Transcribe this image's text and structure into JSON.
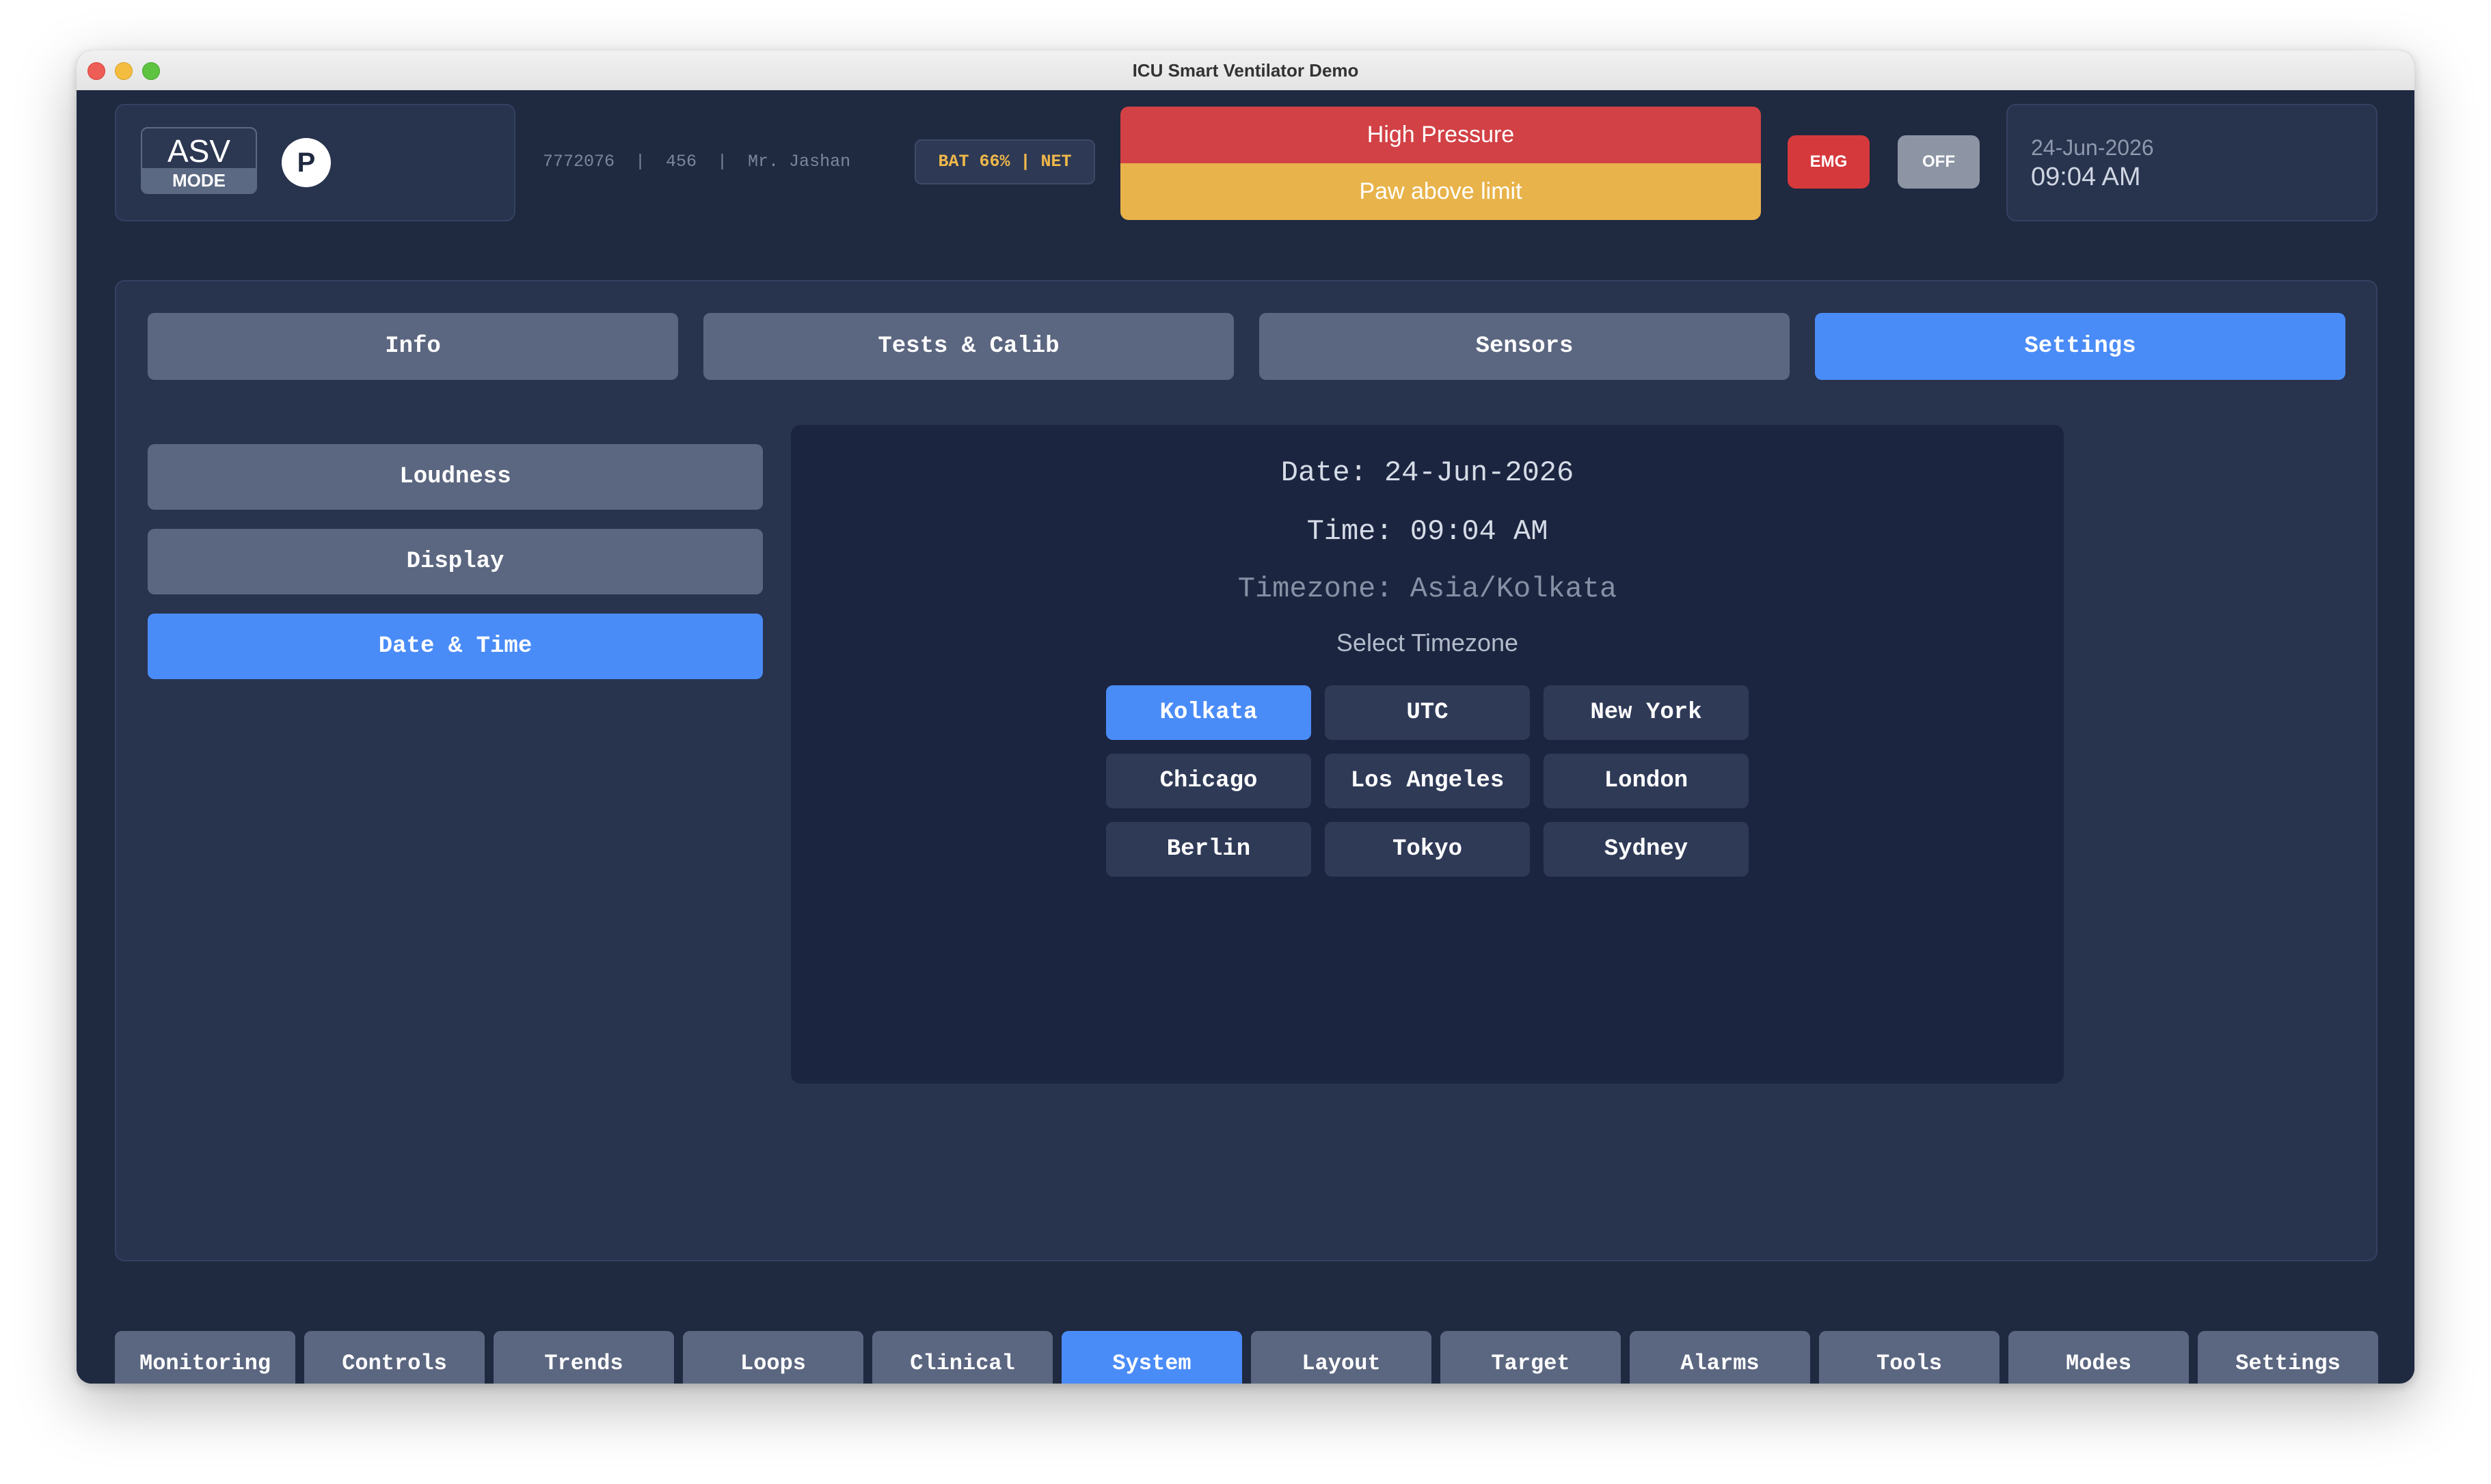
{
  "window": {
    "title": "ICU Smart Ventilator Demo"
  },
  "header": {
    "mode": {
      "name": "ASV",
      "label": "MODE"
    },
    "patient_badge": "P",
    "patient_info": "7772076  |  456  |  Mr. Jashan",
    "status_badge": "BAT 66% | NET",
    "alarms": {
      "primary": "High Pressure",
      "secondary": "Paw above limit"
    },
    "emergency_button": "EMG",
    "off_button": "OFF",
    "date": "24-Jun-2026",
    "time": "09:04 AM"
  },
  "tabs": [
    {
      "label": "Info",
      "active": false
    },
    {
      "label": "Tests & Calib",
      "active": false
    },
    {
      "label": "Sensors",
      "active": false
    },
    {
      "label": "Settings",
      "active": true
    }
  ],
  "sidebar": {
    "items": [
      {
        "label": "Loudness",
        "active": false
      },
      {
        "label": "Display",
        "active": false
      },
      {
        "label": "Date & Time",
        "active": true
      }
    ]
  },
  "datetime_panel": {
    "date_line": "Date: 24-Jun-2026",
    "time_line": "Time: 09:04 AM",
    "timezone_line": "Timezone: Asia/Kolkata",
    "select_label": "Select Timezone",
    "timezones": [
      {
        "label": "Kolkata",
        "active": true
      },
      {
        "label": "UTC",
        "active": false
      },
      {
        "label": "New York",
        "active": false
      },
      {
        "label": "Chicago",
        "active": false
      },
      {
        "label": "Los Angeles",
        "active": false
      },
      {
        "label": "London",
        "active": false
      },
      {
        "label": "Berlin",
        "active": false
      },
      {
        "label": "Tokyo",
        "active": false
      },
      {
        "label": "Sydney",
        "active": false
      }
    ]
  },
  "bottom_nav": [
    {
      "label": "Monitoring",
      "active": false
    },
    {
      "label": "Controls",
      "active": false
    },
    {
      "label": "Trends",
      "active": false
    },
    {
      "label": "Loops",
      "active": false
    },
    {
      "label": "Clinical",
      "active": false
    },
    {
      "label": "System",
      "active": true
    },
    {
      "label": "Layout",
      "active": false
    },
    {
      "label": "Target",
      "active": false
    },
    {
      "label": "Alarms",
      "active": false
    },
    {
      "label": "Tools",
      "active": false
    },
    {
      "label": "Modes",
      "active": false
    },
    {
      "label": "Settings",
      "active": false
    }
  ],
  "colors": {
    "background": "#1f2940",
    "panel": "#28334e",
    "accent": "#4a8cf7",
    "button": "#5b6680",
    "alarm_high": "#d24145",
    "alarm_medium": "#e8b34a",
    "emergency": "#d6393c",
    "status_text": "#f0b84a"
  }
}
